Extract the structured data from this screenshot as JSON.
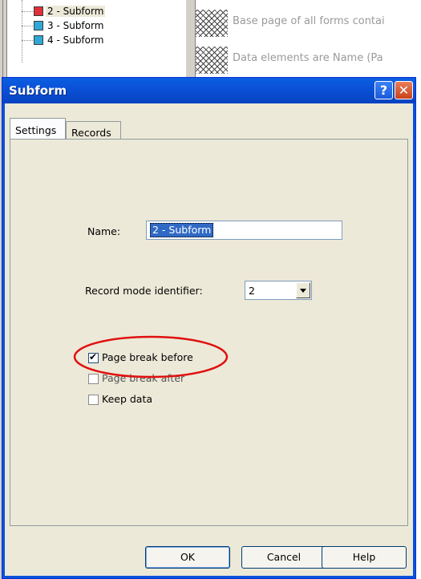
{
  "tree": {
    "items": [
      {
        "label": "2 - Subform",
        "icon": "red-subform-icon",
        "selected": true
      },
      {
        "label": "3 - Subform",
        "icon": "blue-subform-icon",
        "selected": false
      },
      {
        "label": "4 - Subform",
        "icon": "blue-subform-icon",
        "selected": false
      }
    ]
  },
  "background": {
    "desc1": "Base page of all forms contai",
    "desc2": "Data elements are Name (Pa"
  },
  "dialog": {
    "title": "Subform",
    "help_glyph": "?",
    "close_glyph": "✕",
    "tabs": [
      {
        "label": "Settings",
        "active": true
      },
      {
        "label": "Records",
        "active": false
      }
    ],
    "name_label": "Name:",
    "name_value": "2 - Subform",
    "record_mode_label": "Record mode identifier:",
    "record_mode_value": "2",
    "checkboxes": [
      {
        "label": "Page break before",
        "checked": true
      },
      {
        "label": "Page break after",
        "checked": false
      },
      {
        "label": "Keep data",
        "checked": false
      }
    ],
    "buttons": {
      "ok": "OK",
      "cancel": "Cancel",
      "help": "Help"
    }
  },
  "colors": {
    "titlebar": "#0b52d8",
    "highlight_ellipse": "#e01010",
    "selection": "#316ac5"
  }
}
